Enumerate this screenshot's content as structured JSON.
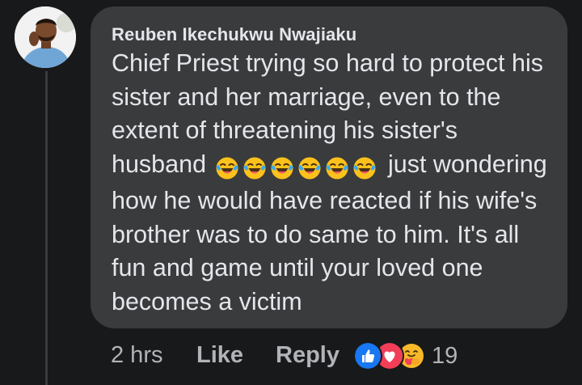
{
  "comment": {
    "author": "Reuben Ikechukwu Nwajiaku",
    "text_before_emojis": "Chief Priest trying so hard to protect his sister and her marriage, even to the extent of threatening his sister's husband",
    "emojis": [
      "face-with-tears-of-joy",
      "face-with-tears-of-joy",
      "face-with-tears-of-joy",
      "face-with-tears-of-joy",
      "face-with-tears-of-joy",
      "face-with-tears-of-joy"
    ],
    "text_after_emojis": "just wondering how he would have reacted if his wife's brother was to do same to him. It's all fun and game until your loved one becomes a victim"
  },
  "actions": {
    "time": "2 hrs",
    "like_label": "Like",
    "reply_label": "Reply",
    "reactions": [
      "like-reaction-icon",
      "love-reaction-icon",
      "care-reaction-icon"
    ],
    "reaction_count": "19"
  },
  "colors": {
    "background": "#18191a",
    "bubble": "#3a3b3c",
    "text": "#e4e6eb",
    "muted": "#b0b3b8",
    "like_blue": "#1877f2",
    "love_red": "#f33e58",
    "care_yellow": "#f7b928"
  }
}
